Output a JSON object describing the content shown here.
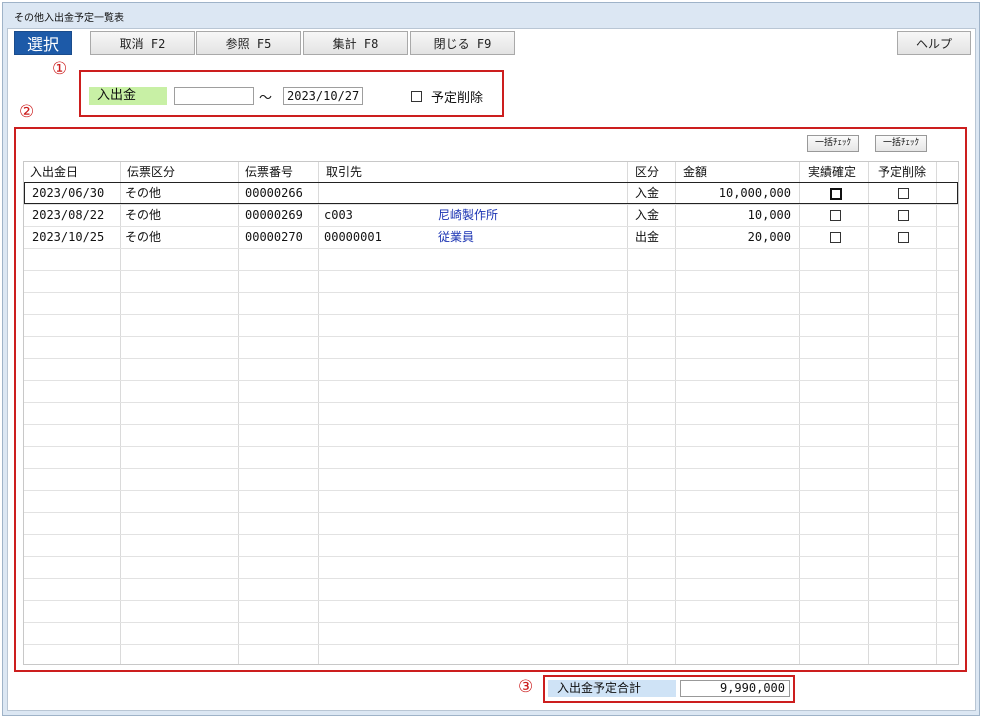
{
  "window": {
    "title": "その他入出金予定一覧表"
  },
  "toolbar": {
    "select": "選択",
    "cancel": "取消 F2",
    "reference": "参照 F5",
    "aggregate": "集計 F8",
    "close": "閉じる F9",
    "help": "ヘルプ"
  },
  "annotations": {
    "one": "①",
    "two": "②",
    "three": "③"
  },
  "filter": {
    "label": "入出金",
    "date_from": "",
    "tilde": "～",
    "date_to": "2023/10/27",
    "delete_scheduled_label": "予定削除",
    "delete_scheduled_checked": false
  },
  "bulk": {
    "confirm_check": "一括ﾁｪｯｸ",
    "delete_check": "一括ﾁｪｯｸ"
  },
  "table": {
    "columns": [
      "入出金日",
      "伝票区分",
      "伝票番号",
      "取引先",
      "区分",
      "金額",
      "実績確定",
      "予定削除"
    ],
    "rows": [
      {
        "date": "2023/06/30",
        "type": "その他",
        "slip": "00000266",
        "code": "",
        "partner": "",
        "kind": "入金",
        "amount": "10,000,000",
        "confirmed": false,
        "delete": false
      },
      {
        "date": "2023/08/22",
        "type": "その他",
        "slip": "00000269",
        "code": "c003",
        "partner": "尼崎製作所",
        "kind": "入金",
        "amount": "10,000",
        "confirmed": false,
        "delete": false
      },
      {
        "date": "2023/10/25",
        "type": "その他",
        "slip": "00000270",
        "code": "00000001",
        "partner": "従業員",
        "kind": "出金",
        "amount": "20,000",
        "confirmed": false,
        "delete": false
      }
    ]
  },
  "total": {
    "label": "入出金予定合計",
    "value": "9,990,000"
  },
  "colors": {
    "accent": "#1d5aa8",
    "annotation": "#cc1e1e",
    "filter_label_bg": "#c8f0a5",
    "total_label_bg": "#cfe3f6",
    "partner_text": "#1a33b3"
  }
}
